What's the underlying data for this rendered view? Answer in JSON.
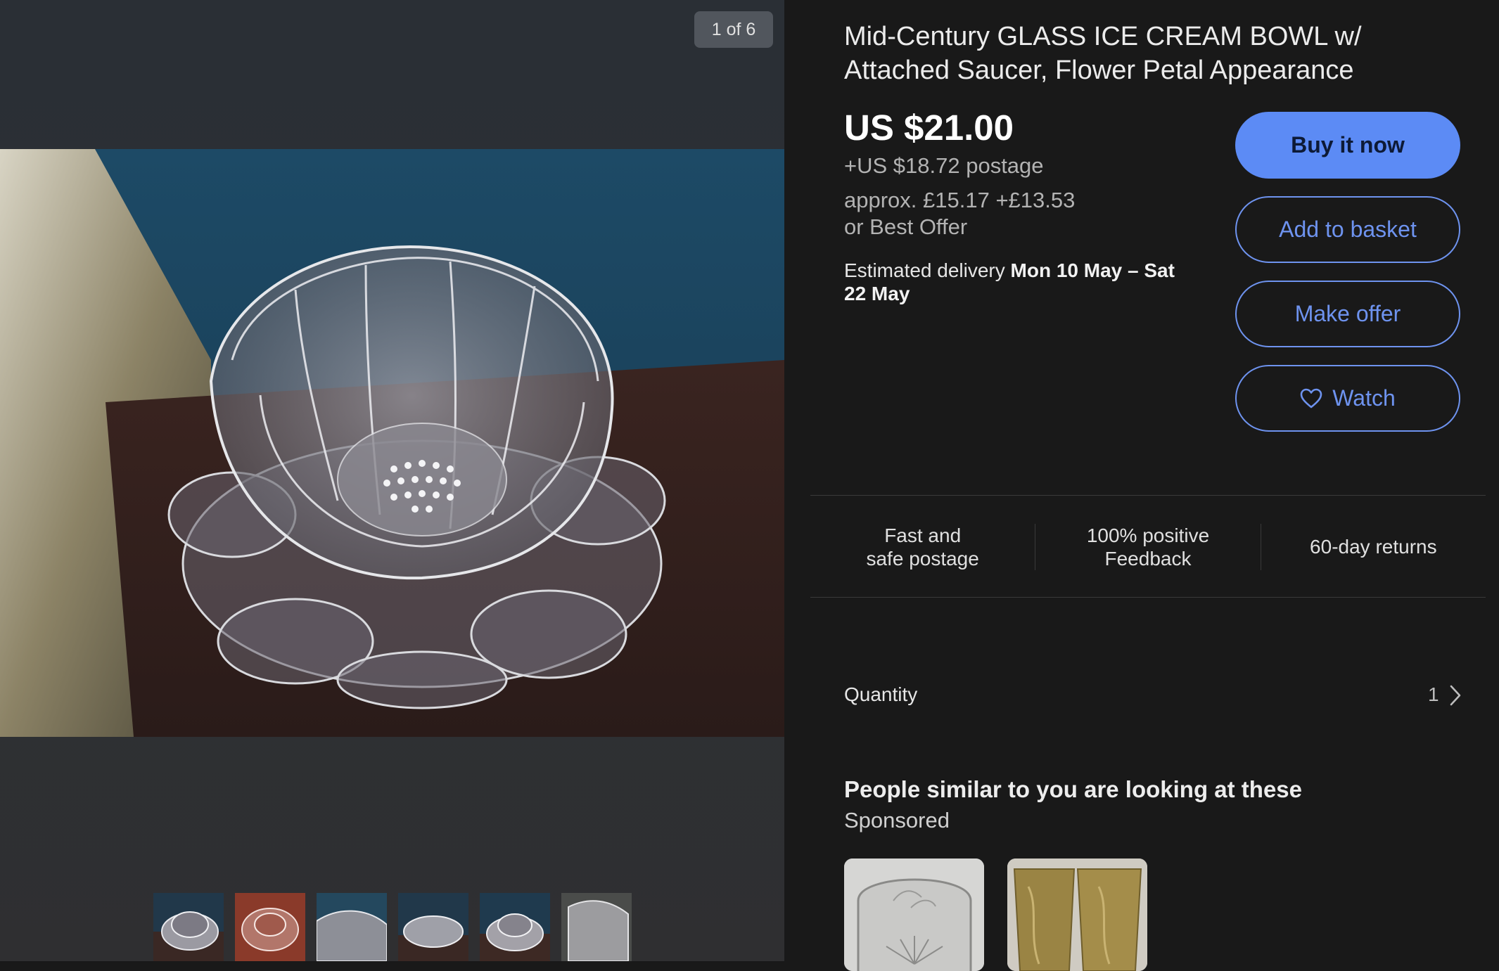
{
  "gallery": {
    "counter": "1 of 6",
    "main_image": "glass-flower-bowl-photo",
    "thumbnail_count": 6
  },
  "listing": {
    "title": "Mid-Century GLASS ICE CREAM BOWL w/ Attached Saucer, Flower Petal Appearance",
    "price": "US $21.00",
    "postage": "+US $18.72 postage",
    "approx": "approx. £15.17 +£13.53",
    "best_offer": "or Best Offer",
    "delivery_prefix": "Estimated delivery ",
    "delivery_dates": "Mon 10 May – Sat 22 May"
  },
  "actions": {
    "buy": "Buy it now",
    "basket": "Add to basket",
    "offer": "Make offer",
    "watch": "Watch"
  },
  "features": {
    "postage_line1": "Fast and",
    "postage_line2": "safe postage",
    "feedback_line1": "100% positive",
    "feedback_line2": "Feedback",
    "returns": "60-day returns"
  },
  "quantity": {
    "label": "Quantity",
    "value": "1"
  },
  "similar": {
    "title": "People similar to you are looking at these",
    "sponsored": "Sponsored"
  },
  "colors": {
    "accent": "#5c8bf5",
    "outline": "#6e93ef",
    "background": "#191919"
  }
}
